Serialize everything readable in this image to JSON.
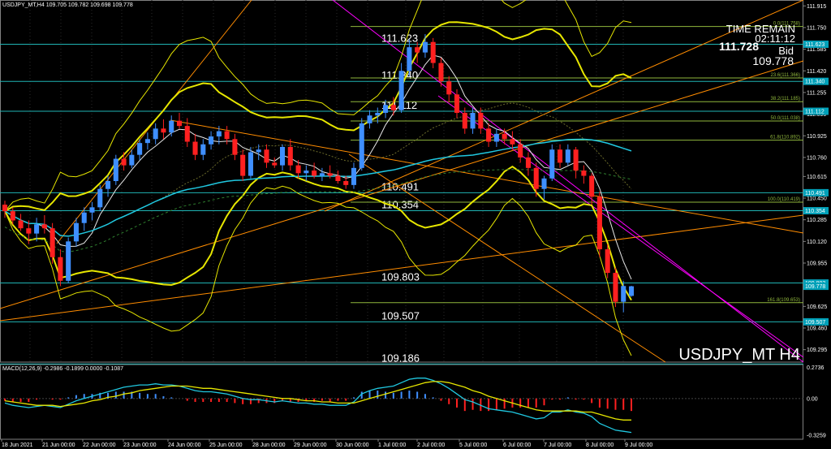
{
  "header": {
    "symbol_info": "USDJPY_MT,H4",
    "ohlc": "109.705 109.782 109.698 109.778"
  },
  "overlay": {
    "time_remain_label": "TIME REMAIN",
    "time_remain_value": "02:11:12",
    "price_big": "111.728",
    "bid_label": "Bid",
    "bid_value": "109.778",
    "watermark": "USDJPY_MT H4"
  },
  "colors": {
    "background": "#000000",
    "bull": "#3f8fff",
    "bear": "#ff2020",
    "hline": "#1fb3b3",
    "fib": "#8fb63c",
    "band": "#e6e600",
    "trend_orange": "#ff8c00",
    "channel_magenta": "#ff00ff",
    "ma_cyan": "#20c8e0",
    "macd_signal": "#e6e600",
    "macd_line": "#20c8e0",
    "macd_hist_pos": "#3f8fff",
    "macd_hist_neg": "#ff2020",
    "tag_bg": "#00a0b8"
  },
  "chart_data": [
    {
      "type": "candlestick",
      "title": "USDJPY_MT,H4",
      "y_ticks": [
        "111.915",
        "111.750",
        "111.585",
        "111.420",
        "111.255",
        "111.090",
        "110.925",
        "110.760",
        "110.615",
        "110.450",
        "110.285",
        "110.120",
        "109.955",
        "109.790",
        "109.625",
        "109.460",
        "109.295"
      ],
      "ylim": [
        109.2,
        111.96
      ],
      "x_ticks": [
        "18 Jun 2021",
        "21 Jun 00:00",
        "22 Jun 00:00",
        "23 Jun 00:00",
        "24 Jun 00:00",
        "25 Jun 00:00",
        "28 Jun 00:00",
        "29 Jun 00:00",
        "30 Jun 00:00",
        "1 Jul 00:00",
        "2 Jul 00:00",
        "5 Jul 00:00",
        "6 Jul 00:00",
        "7 Jul 00:00",
        "8 Jul 00:00",
        "9 Jul 00:00"
      ],
      "candles": [
        [
          110.4,
          110.43,
          110.3,
          110.35
        ],
        [
          110.35,
          110.38,
          110.25,
          110.28
        ],
        [
          110.28,
          110.33,
          110.2,
          110.22
        ],
        [
          110.22,
          110.28,
          110.1,
          110.18
        ],
        [
          110.18,
          110.3,
          110.12,
          110.25
        ],
        [
          110.25,
          110.32,
          110.18,
          110.22
        ],
        [
          110.22,
          110.26,
          109.95,
          110.0
        ],
        [
          110.0,
          110.06,
          109.78,
          109.82
        ],
        [
          109.82,
          110.15,
          109.8,
          110.12
        ],
        [
          110.12,
          110.3,
          110.08,
          110.26
        ],
        [
          110.26,
          110.38,
          110.2,
          110.34
        ],
        [
          110.34,
          110.42,
          110.28,
          110.38
        ],
        [
          110.38,
          110.55,
          110.35,
          110.52
        ],
        [
          110.52,
          110.62,
          110.46,
          110.58
        ],
        [
          110.58,
          110.78,
          110.55,
          110.75
        ],
        [
          110.75,
          110.8,
          110.66,
          110.7
        ],
        [
          110.7,
          110.82,
          110.68,
          110.78
        ],
        [
          110.78,
          110.9,
          110.74,
          110.87
        ],
        [
          110.87,
          110.95,
          110.82,
          110.9
        ],
        [
          110.9,
          111.02,
          110.86,
          110.98
        ],
        [
          110.98,
          111.05,
          110.9,
          110.95
        ],
        [
          110.95,
          111.08,
          110.92,
          111.04
        ],
        [
          111.04,
          111.1,
          110.98,
          111.0
        ],
        [
          111.0,
          111.06,
          110.84,
          110.88
        ],
        [
          110.88,
          110.94,
          110.74,
          110.78
        ],
        [
          110.78,
          110.9,
          110.74,
          110.86
        ],
        [
          110.86,
          110.96,
          110.82,
          110.92
        ],
        [
          110.92,
          111.0,
          110.86,
          110.96
        ],
        [
          110.96,
          111.0,
          110.86,
          110.9
        ],
        [
          110.9,
          110.94,
          110.74,
          110.78
        ],
        [
          110.78,
          110.82,
          110.58,
          110.62
        ],
        [
          110.62,
          110.84,
          110.6,
          110.8
        ],
        [
          110.8,
          110.86,
          110.74,
          110.82
        ],
        [
          110.82,
          110.86,
          110.68,
          110.72
        ],
        [
          110.72,
          110.76,
          110.68,
          110.7
        ],
        [
          110.7,
          110.86,
          110.66,
          110.84
        ],
        [
          110.84,
          110.9,
          110.66,
          110.7
        ],
        [
          110.7,
          110.74,
          110.6,
          110.64
        ],
        [
          110.64,
          110.7,
          110.58,
          110.66
        ],
        [
          110.66,
          110.72,
          110.6,
          110.62
        ],
        [
          110.62,
          110.68,
          110.58,
          110.64
        ],
        [
          110.64,
          110.7,
          110.6,
          110.62
        ],
        [
          110.62,
          110.66,
          110.56,
          110.58
        ],
        [
          110.58,
          110.62,
          110.52,
          110.55
        ],
        [
          110.55,
          110.72,
          110.52,
          110.68
        ],
        [
          110.68,
          111.06,
          110.66,
          111.02
        ],
        [
          111.02,
          111.12,
          110.98,
          111.08
        ],
        [
          111.08,
          111.14,
          111.02,
          111.1
        ],
        [
          111.1,
          111.2,
          111.06,
          111.16
        ],
        [
          111.16,
          111.22,
          111.08,
          111.12
        ],
        [
          111.12,
          111.48,
          111.1,
          111.42
        ],
        [
          111.42,
          111.66,
          111.38,
          111.6
        ],
        [
          111.6,
          111.64,
          111.48,
          111.56
        ],
        [
          111.56,
          111.7,
          111.52,
          111.64
        ],
        [
          111.64,
          111.67,
          111.44,
          111.48
        ],
        [
          111.48,
          111.52,
          111.3,
          111.34
        ],
        [
          111.34,
          111.38,
          111.18,
          111.24
        ],
        [
          111.24,
          111.28,
          111.06,
          111.1
        ],
        [
          111.1,
          111.14,
          110.94,
          110.98
        ],
        [
          110.98,
          111.14,
          110.94,
          111.1
        ],
        [
          111.1,
          111.14,
          110.94,
          110.98
        ],
        [
          110.98,
          111.02,
          110.84,
          110.88
        ],
        [
          110.88,
          110.98,
          110.84,
          110.94
        ],
        [
          110.94,
          110.98,
          110.86,
          110.9
        ],
        [
          110.9,
          110.96,
          110.82,
          110.86
        ],
        [
          110.86,
          110.9,
          110.72,
          110.76
        ],
        [
          110.76,
          110.8,
          110.62,
          110.68
        ],
        [
          110.68,
          110.72,
          110.46,
          110.52
        ],
        [
          110.52,
          110.62,
          110.44,
          110.6
        ],
        [
          110.6,
          110.86,
          110.58,
          110.82
        ],
        [
          110.82,
          110.86,
          110.68,
          110.72
        ],
        [
          110.72,
          110.86,
          110.7,
          110.82
        ],
        [
          110.82,
          110.84,
          110.6,
          110.66
        ],
        [
          110.66,
          110.7,
          110.56,
          110.62
        ],
        [
          110.62,
          110.64,
          110.4,
          110.46
        ],
        [
          110.46,
          110.5,
          110.0,
          110.06
        ],
        [
          110.06,
          110.1,
          109.84,
          109.88
        ],
        [
          109.88,
          109.92,
          109.62,
          109.66
        ],
        [
          109.66,
          109.82,
          109.58,
          109.78
        ],
        [
          109.705,
          109.782,
          109.698,
          109.778
        ]
      ],
      "horizontal_levels": [
        {
          "label": "111.623",
          "value": 111.623
        },
        {
          "label": "111.340",
          "value": 111.34
        },
        {
          "label": "111.112",
          "value": 111.112
        },
        {
          "label": "110.491",
          "value": 110.491
        },
        {
          "label": "110.354",
          "value": 110.354
        },
        {
          "label": "109.803",
          "value": 109.803
        },
        {
          "label": "109.507",
          "value": 109.507
        },
        {
          "label": "109.186",
          "value": 109.186
        }
      ],
      "right_tags": [
        "111.623",
        "111.340",
        "111.112",
        "110.491",
        "110.354",
        "109.803",
        "109.778",
        "109.507"
      ],
      "fibonacci": [
        {
          "label": "0.0(111.758)",
          "value": 111.758
        },
        {
          "label": "23.6(111.366)",
          "value": 111.366
        },
        {
          "label": "38.2(111.185)",
          "value": 111.185
        },
        {
          "label": "50.0(111.038)",
          "value": 111.038
        },
        {
          "label": "61.8(110.892)",
          "value": 110.892
        },
        {
          "label": "100.0(110.419)",
          "value": 110.419
        },
        {
          "label": "161.8(109.653)",
          "value": 109.653
        }
      ]
    },
    {
      "type": "bar",
      "title": "MACD(12,26,9) -0.2986 -0.1899 0.0000 -0.1087",
      "y_ticks": [
        "0.2736",
        "0.00",
        "-0.3259"
      ],
      "ylim": [
        -0.36,
        0.3
      ],
      "series": [
        {
          "values": [
            -0.04,
            -0.06,
            -0.07,
            -0.08,
            -0.07,
            -0.06,
            -0.07,
            -0.08,
            -0.05,
            -0.02,
            0.0,
            0.02,
            0.04,
            0.06,
            0.08,
            0.1,
            0.11,
            0.12,
            0.12,
            0.13,
            0.12,
            0.12,
            0.11,
            0.09,
            0.07,
            0.06,
            0.06,
            0.05,
            0.04,
            0.02,
            0.0,
            -0.01,
            -0.01,
            -0.02,
            -0.03,
            -0.02,
            -0.03,
            -0.04,
            -0.04,
            -0.05,
            -0.05,
            -0.06,
            -0.06,
            -0.06,
            -0.03,
            0.04,
            0.07,
            0.09,
            0.1,
            0.11,
            0.14,
            0.17,
            0.18,
            0.18,
            0.16,
            0.13,
            0.09,
            0.04,
            -0.01,
            -0.03,
            -0.06,
            -0.09,
            -0.1,
            -0.11,
            -0.12,
            -0.14,
            -0.16,
            -0.18,
            -0.17,
            -0.12,
            -0.12,
            -0.1,
            -0.12,
            -0.13,
            -0.16,
            -0.22,
            -0.25,
            -0.28,
            -0.29,
            -0.3
          ]
        },
        {
          "values": [
            -0.02,
            -0.03,
            -0.04,
            -0.05,
            -0.06,
            -0.06,
            -0.06,
            -0.07,
            -0.06,
            -0.05,
            -0.04,
            -0.02,
            -0.01,
            0.01,
            0.02,
            0.04,
            0.05,
            0.07,
            0.08,
            0.09,
            0.1,
            0.11,
            0.11,
            0.11,
            0.1,
            0.09,
            0.09,
            0.08,
            0.07,
            0.06,
            0.05,
            0.04,
            0.03,
            0.02,
            0.01,
            0.0,
            0.0,
            -0.01,
            -0.02,
            -0.02,
            -0.03,
            -0.03,
            -0.04,
            -0.04,
            -0.04,
            -0.02,
            0.0,
            0.02,
            0.04,
            0.06,
            0.08,
            0.1,
            0.12,
            0.14,
            0.15,
            0.15,
            0.14,
            0.12,
            0.1,
            0.07,
            0.05,
            0.02,
            0.0,
            -0.02,
            -0.04,
            -0.06,
            -0.08,
            -0.1,
            -0.11,
            -0.11,
            -0.11,
            -0.11,
            -0.11,
            -0.12,
            -0.12,
            -0.14,
            -0.16,
            -0.18,
            -0.19,
            -0.19
          ]
        },
        {
          "values": [
            -0.02,
            -0.03,
            -0.03,
            -0.03,
            -0.01,
            0.0,
            -0.01,
            -0.01,
            0.01,
            0.03,
            0.04,
            0.04,
            0.05,
            0.05,
            0.06,
            0.06,
            0.06,
            0.05,
            0.04,
            0.04,
            0.02,
            0.01,
            0.0,
            -0.02,
            -0.03,
            -0.03,
            -0.03,
            -0.03,
            -0.03,
            -0.04,
            -0.05,
            -0.05,
            -0.04,
            -0.04,
            -0.04,
            -0.02,
            -0.03,
            -0.03,
            -0.02,
            -0.03,
            -0.02,
            -0.03,
            -0.02,
            -0.02,
            0.01,
            0.06,
            0.07,
            0.07,
            0.06,
            0.05,
            0.06,
            0.07,
            0.06,
            0.04,
            0.01,
            -0.02,
            -0.05,
            -0.08,
            -0.11,
            -0.1,
            -0.11,
            -0.11,
            -0.1,
            -0.09,
            -0.08,
            -0.08,
            -0.08,
            -0.08,
            -0.06,
            -0.01,
            -0.01,
            0.01,
            -0.01,
            -0.01,
            -0.04,
            -0.08,
            -0.09,
            -0.1,
            -0.1,
            -0.11
          ]
        }
      ]
    }
  ]
}
